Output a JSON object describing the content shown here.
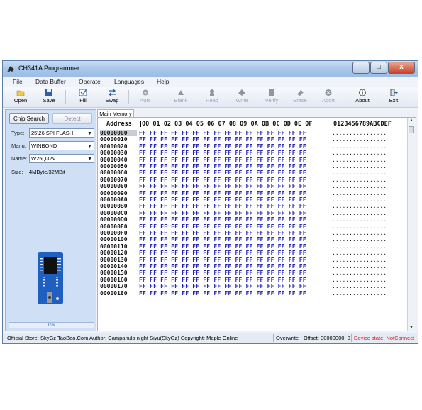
{
  "window": {
    "title": "CH341A Programmer",
    "controls": {
      "minimize": "–",
      "maximize": "□",
      "close": "x"
    }
  },
  "menu": [
    "File",
    "Data Buffer",
    "Operate",
    "Languages",
    "Help"
  ],
  "toolbar": {
    "open": "Open",
    "save": "Save",
    "fill": "Fill",
    "swap": "Swap",
    "auto": "Auto",
    "blank": "Blank",
    "read": "Read",
    "write": "Write",
    "verify": "Verify",
    "erase": "Erase",
    "abort": "Abort",
    "about": "About",
    "exit": "Exit"
  },
  "chip_panel": {
    "chip_search": "Chip Search",
    "detect": "Detect",
    "type_label": "Type:",
    "type_value": "25\\26 SPI FLASH",
    "manu_label": "Manu:",
    "manu_value": "WINBOND",
    "name_label": "Name:",
    "name_value": "W25Q32V",
    "size_label": "Size:",
    "size_value": "4MByte/32MBit",
    "progress": "0%"
  },
  "editor": {
    "tab": "Main Memory",
    "address_header": "Address",
    "column_header": "00 01 02 03 04 05 06 07 08 09 0A 0B 0C 0D 0E 0F",
    "ascii_header": "0123456789ABCDEF",
    "hex_row": "FF FF FF FF FF FF FF FF FF FF FF FF FF FF FF FF",
    "ascii_row": "................",
    "addresses": [
      "00000000",
      "00000010",
      "00000020",
      "00000030",
      "00000040",
      "00000050",
      "00000060",
      "00000070",
      "00000080",
      "00000090",
      "000000A0",
      "000000B0",
      "000000C0",
      "000000D0",
      "000000E0",
      "000000F0",
      "00000100",
      "00000110",
      "00000120",
      "00000130",
      "00000140",
      "00000150",
      "00000160",
      "00000170",
      "00000180"
    ]
  },
  "status": {
    "store": "Official Store: SkyGz TaoBao.Com Author: Campanula night Siyu(SkyGz) Copyright: Maple Online",
    "mode": "Overwrite",
    "offset": "Offset: 00000000, 0",
    "device_state": "Device state: NotConnect",
    "device_state_color": "#d02020"
  }
}
